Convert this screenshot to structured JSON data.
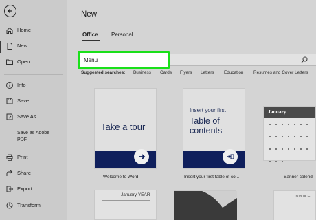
{
  "sidebar": {
    "items": [
      {
        "label": "Home",
        "icon": "home-icon"
      },
      {
        "label": "New",
        "icon": "new-document-icon"
      },
      {
        "label": "Open",
        "icon": "folder-open-icon"
      },
      {
        "label": "Info",
        "icon": "info-icon"
      },
      {
        "label": "Save",
        "icon": "save-icon"
      },
      {
        "label": "Save As",
        "icon": "save-as-icon"
      },
      {
        "label": "Save as Adobe",
        "label2": "PDF",
        "icon": "pdf-icon"
      },
      {
        "label": "Print",
        "icon": "print-icon"
      },
      {
        "label": "Share",
        "icon": "share-icon"
      },
      {
        "label": "Export",
        "icon": "export-icon"
      },
      {
        "label": "Transform",
        "icon": "transform-icon"
      }
    ]
  },
  "header": {
    "title": "New"
  },
  "tabs": [
    {
      "label": "Office"
    },
    {
      "label": "Personal"
    }
  ],
  "search": {
    "value": "Menu"
  },
  "suggested": {
    "label": "Suggested searches:",
    "items": [
      "Business",
      "Cards",
      "Flyers",
      "Letters",
      "Education",
      "Resumes and Cover Letters"
    ]
  },
  "templates": [
    {
      "title": "Take a tour",
      "caption": "Welcome to Word"
    },
    {
      "title_small": "Insert your first",
      "title_big_1": "Table of",
      "title_big_2": "contents",
      "caption": "Insert your first table of co..."
    },
    {
      "header": "January",
      "caption": "Banner calend"
    }
  ],
  "bottom_cards": {
    "calendar_header": "January YEAR",
    "invoice_header": "INVOICE"
  },
  "colors": {
    "highlight": "#1ae01a",
    "navy": "#0f1f5c"
  }
}
